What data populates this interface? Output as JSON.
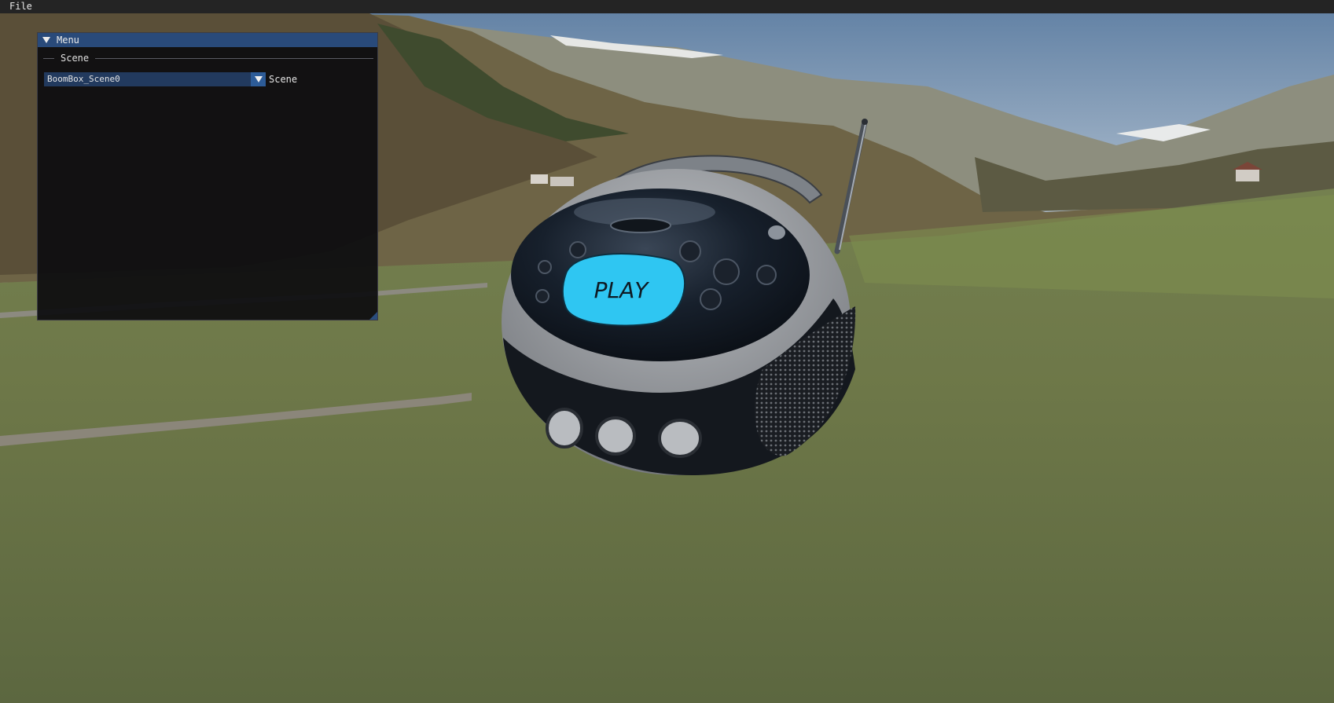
{
  "menubar": {
    "items": [
      "File"
    ]
  },
  "window": {
    "title": "Menu",
    "section_label": "Scene",
    "combo": {
      "value": "BoomBox_Scene0",
      "label": "Scene"
    }
  },
  "viewport": {
    "model_label": "PLAY"
  },
  "colors": {
    "menubar_bg": "#242424",
    "title_bg": "#294a7a",
    "combo_bg": "#223a5e",
    "combo_button": "#2d5c98",
    "play_button": "#2fc6f2"
  }
}
